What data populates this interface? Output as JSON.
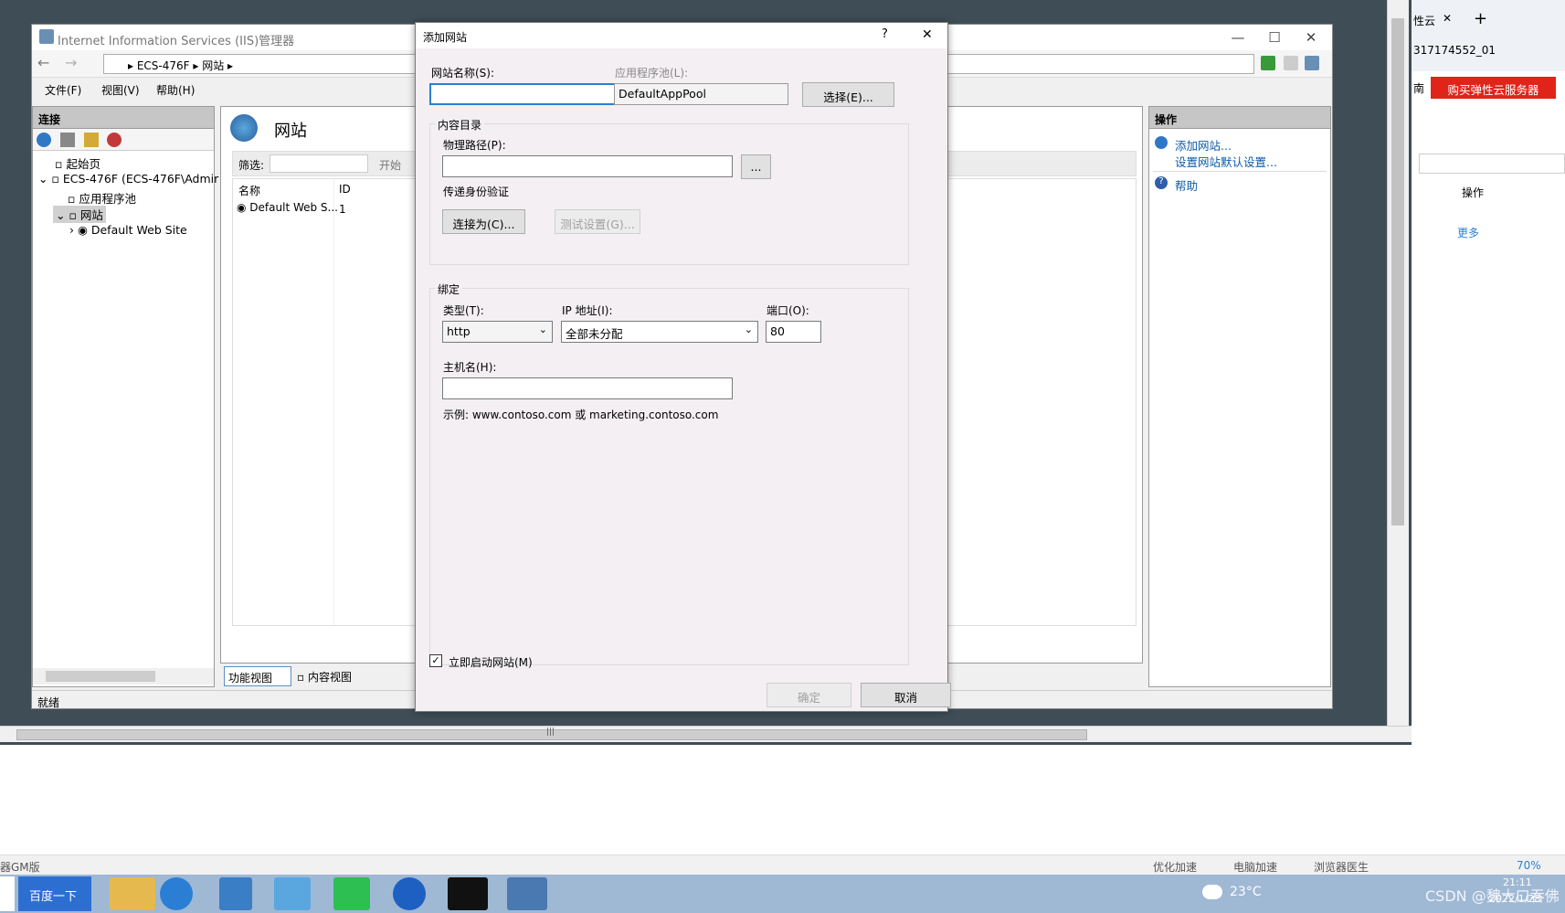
{
  "iis": {
    "title": "Internet Information Services (IIS)管理器",
    "breadcrumb": [
      "ECS-476F",
      "网站"
    ],
    "menu": [
      "文件(F)",
      "视图(V)",
      "帮助(H)"
    ],
    "connections_title": "连接",
    "tree": [
      "起始页",
      "ECS-476F (ECS-476F\\Admir",
      "应用程序池",
      "网站",
      "Default Web Site"
    ],
    "center_title": "网站",
    "filter_label": "筛选:",
    "filter_go": "开始",
    "col_name": "名称",
    "col_id": "ID",
    "row_name": "Default Web S...",
    "row_id": "1",
    "view_feature": "功能视图",
    "view_content": "内容视图",
    "actions_title": "操作",
    "action_add": "添加网站...",
    "action_defaults": "设置网站默认设置...",
    "action_help": "帮助",
    "status": "就绪"
  },
  "dialog": {
    "title": "添加网站",
    "help": "?",
    "close": "✕",
    "site_name_label": "网站名称(S):",
    "site_name_value": "",
    "app_pool_label": "应用程序池(L):",
    "app_pool_value": "DefaultAppPool",
    "select_button": "选择(E)...",
    "content_dir_group": "内容目录",
    "physical_path_label": "物理路径(P):",
    "physical_path_value": "",
    "browse_button": "...",
    "pass_auth_label": "传递身份验证",
    "connect_as_button": "连接为(C)...",
    "test_settings_button": "测试设置(G)...",
    "binding_group": "绑定",
    "type_label": "类型(T):",
    "type_value": "http",
    "ip_label": "IP 地址(I):",
    "ip_value": "全部未分配",
    "port_label": "端口(O):",
    "port_value": "80",
    "host_label": "主机名(H):",
    "host_value": "",
    "example_text": "示例: www.contoso.com 或 marketing.contoso.com",
    "start_checkbox_label": "立即启动网站(M)",
    "start_checked": true,
    "ok_button": "确定",
    "cancel_button": "取消"
  },
  "browser": {
    "tab_fragment": "性云",
    "id_fragment": "317174552_01",
    "nav_fragment": "南",
    "buy_button": "购买弹性云服务器",
    "column_ops": "操作",
    "more_link": "更多",
    "left_fragment": "器GM版",
    "status_items": [
      "优化加速",
      "电脑加速",
      "浏览器医生",
      "70%"
    ]
  },
  "taskbar": {
    "search_button": "百度一下",
    "weather": "23°C",
    "watermark": "CSDN @魏大口吞佛",
    "time": "21:11",
    "date": "2022/1/28"
  }
}
